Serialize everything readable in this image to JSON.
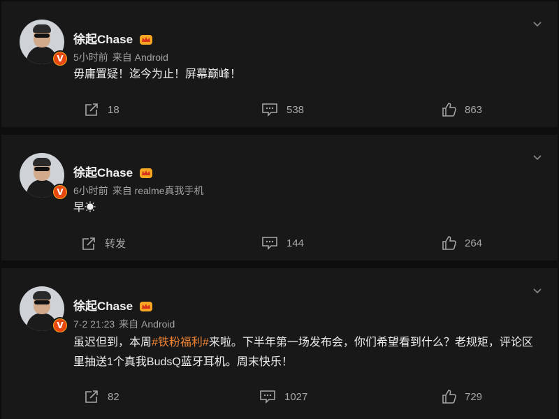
{
  "posts": [
    {
      "author": "徐起Chase",
      "time": "5小时前",
      "source": "来自 Android",
      "text": "毋庸置疑！迄今为止！屏幕巅峰！",
      "reposts": "18",
      "comments": "538",
      "likes": "863"
    },
    {
      "author": "徐起Chase",
      "time": "6小时前",
      "source": "来自 realme真我手机",
      "text": "早☀",
      "reposts": "转发",
      "comments": "144",
      "likes": "264"
    },
    {
      "author": "徐起Chase",
      "time": "7-2 21:23",
      "source": "来自 Android",
      "text_before": "虽迟但到，本周",
      "topic": "#铁粉福利#",
      "text_after": "来啦。下半年第一场发布会，你们希望看到什么？老规矩，评论区里抽送1个真我BudsQ蓝牙耳机。周末快乐！",
      "reposts": "82",
      "comments": "1027",
      "likes": "729"
    }
  ],
  "icons": {
    "verified": "V",
    "crown": "crown-icon",
    "menu": "chevron-down-icon",
    "repost": "repost-icon",
    "comment": "comment-icon",
    "like": "thumbs-up-icon"
  },
  "colors": {
    "background": "#0e0e0e",
    "card": "#181819",
    "topic": "#ee8233",
    "badge": "#e8470f"
  }
}
